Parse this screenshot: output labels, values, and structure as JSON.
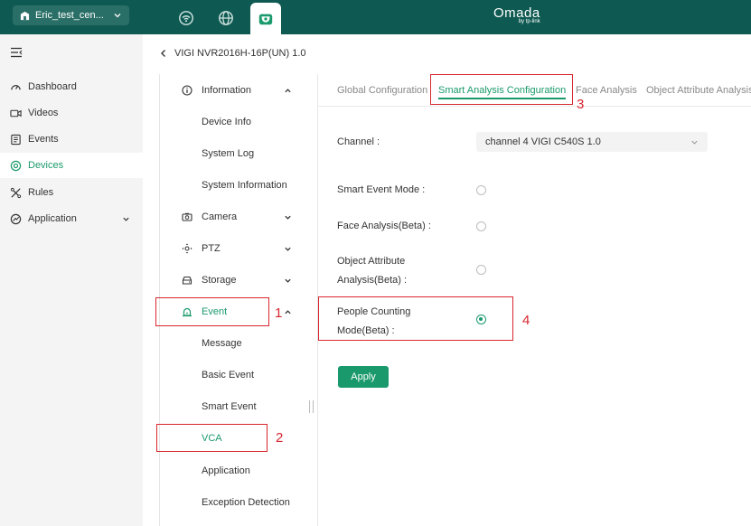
{
  "topbar": {
    "site_name": "Eric_test_cen...",
    "brand_name": "Omada",
    "brand_sub": "by tp-link",
    "tabs": [
      {
        "icon": "wifi-router-icon",
        "active": false
      },
      {
        "icon": "globe-icon",
        "active": false
      },
      {
        "icon": "camera-dome-icon",
        "active": true
      }
    ]
  },
  "sidebar": {
    "items": [
      {
        "label": "Dashboard",
        "icon": "dashboard-icon",
        "active": false
      },
      {
        "label": "Videos",
        "icon": "video-icon",
        "active": false
      },
      {
        "label": "Events",
        "icon": "events-icon",
        "active": false
      },
      {
        "label": "Devices",
        "icon": "devices-icon",
        "active": true
      },
      {
        "label": "Rules",
        "icon": "rules-icon",
        "active": false
      },
      {
        "label": "Application",
        "icon": "application-icon",
        "active": false,
        "expandable": true
      }
    ]
  },
  "breadcrumb": {
    "device_title": "VIGI NVR2016H-16P(UN) 1.0"
  },
  "device_menu": {
    "information": "Information",
    "device_info": "Device Info",
    "system_log": "System Log",
    "system_information": "System Information",
    "camera": "Camera",
    "ptz": "PTZ",
    "storage": "Storage",
    "event": "Event",
    "message": "Message",
    "basic_event": "Basic Event",
    "smart_event": "Smart Event",
    "vca": "VCA",
    "application": "Application",
    "exception_detection": "Exception Detection"
  },
  "tabs": {
    "global_configuration": "Global Configuration",
    "smart_analysis_configuration": "Smart Analysis Configuration",
    "face_analysis": "Face Analysis",
    "object_attribute_analysis": "Object Attribute Analysis"
  },
  "form": {
    "channel_label": "Channel :",
    "channel_value": "channel 4 VIGI C540S 1.0",
    "smart_event_mode": "Smart Event Mode :",
    "face_analysis_beta": "Face Analysis(Beta) :",
    "object_attribute_line1": "Object Attribute",
    "object_attribute_line2": "Analysis(Beta) :",
    "people_counting_line1": "People Counting",
    "people_counting_line2": "Mode(Beta) :",
    "selected_mode": "people_counting",
    "apply_label": "Apply"
  },
  "annotations": {
    "n1": "1",
    "n2": "2",
    "n3": "3",
    "n4": "4"
  },
  "colors": {
    "topbar": "#0e5a52",
    "accent": "#1a9a6c",
    "annotation": "#d8262e"
  }
}
